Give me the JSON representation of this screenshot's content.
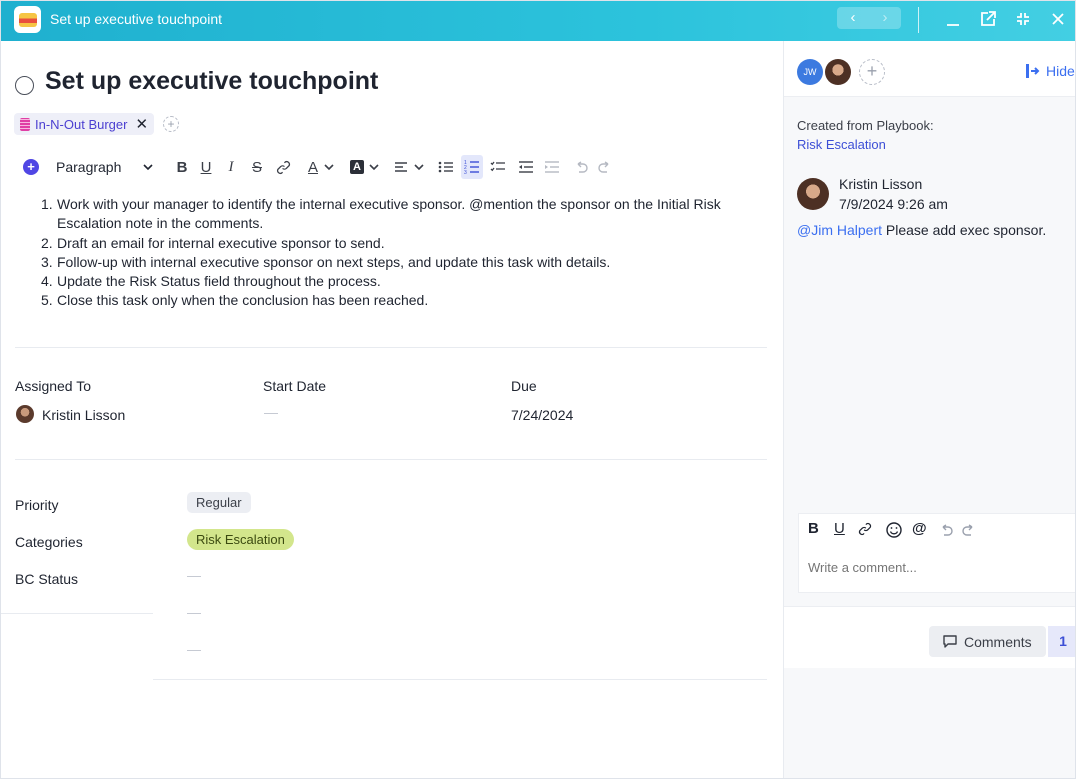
{
  "window": {
    "title": "Set up executive touchpoint",
    "nav_prev": "‹",
    "nav_next": "›"
  },
  "task": {
    "title": "Set up executive touchpoint",
    "tag": "In-N-Out Burger",
    "tag_remove": "✕",
    "add_tag": "+"
  },
  "editor": {
    "paragraph_select": "Paragraph",
    "add_block": "+",
    "tools": {
      "bold": "B",
      "underline": "U",
      "italic": "I",
      "strike": "S",
      "text_color": "A",
      "highlight": "A"
    },
    "steps": [
      {
        "num": "1.",
        "text": "Work with your manager to identify the internal executive sponsor. @mention the sponsor on the Initial Risk Escalation note in the comments."
      },
      {
        "num": "2.",
        "text": "Draft an email for internal executive sponsor to send."
      },
      {
        "num": "3.",
        "text": "Follow-up with internal executive sponsor on next steps, and update this task with details."
      },
      {
        "num": "4.",
        "text": "Update the Risk Status field throughout the process."
      },
      {
        "num": "5.",
        "text": "Close this task only when the conclusion has been reached."
      }
    ]
  },
  "fields": {
    "assigned_to_label": "Assigned To",
    "assigned_to_value": "Kristin Lisson",
    "start_date_label": "Start Date",
    "due_label": "Due",
    "due_value": "7/24/2024",
    "priority_label": "Priority",
    "priority_value": "Regular",
    "categories_label": "Categories",
    "categories_value": "Risk Escalation",
    "bc_status_label": "BC Status"
  },
  "panel": {
    "jw_initials": "JW",
    "add_follower": "+",
    "hide_label": "Hide",
    "created_from_label": "Created from Playbook:",
    "playbook_name": "Risk Escalation",
    "comment": {
      "author": "Kristin Lisson",
      "time": "7/9/2024 9:26 am",
      "mention": "@Jim Halpert",
      "text": " Please add exec sponsor.",
      "menu": "⋮"
    },
    "composer": {
      "placeholder": "Write a comment...",
      "bold": "B",
      "underline": "U",
      "at": "@"
    },
    "comments_button": "Comments",
    "comments_count": "1"
  },
  "colors": {
    "titlebar": "#2cc3dc",
    "accent": "#5046e4",
    "link": "#3b6ff0",
    "category_chip": "#d3e68c"
  }
}
